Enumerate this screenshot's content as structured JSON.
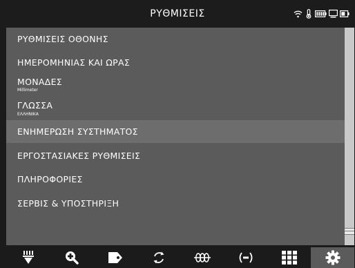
{
  "header": {
    "title": "ΡΥΘΜΙΣΕΙΣ"
  },
  "status_icons": [
    "wifi-icon",
    "temperature-icon",
    "battery-icon",
    "device-icon",
    "battery-level-icon"
  ],
  "menu": {
    "items": [
      {
        "label": "ΡΥΘΜΙΣΕΙΣ ΟΘΟΝΗΣ"
      },
      {
        "label": "ΗΜΕΡΟΜΗΝΙΑΣ ΚΑΙ ΩΡΑΣ"
      },
      {
        "label": "ΜΟΝΑΔΕΣ",
        "sub": "Millimeter"
      },
      {
        "label": "ΓΛΩΣΣΑ",
        "sub": "ΕΛΛΗΝΙΚΑ"
      },
      {
        "label": "ΕΝΗΜΕΡΩΣΗ ΣΥΣΤΗΜΑΤΟΣ",
        "highlighted": true
      },
      {
        "label": "ΕΡΓΟΣΤΑΣΙΑΚΕΣ ΡΥΘΜΙΣΕΙΣ"
      },
      {
        "label": "ΠΛΗΡΟΦΟΡΙΕΣ"
      },
      {
        "label": "ΣΕΡΒΙΣ & ΥΠΟΣΤΗΡΙΞΗ"
      }
    ]
  },
  "scrollbar": {
    "position": 0.95
  },
  "tabbar": {
    "tabs": [
      {
        "icon": "probe-icon"
      },
      {
        "icon": "zoom-in-icon"
      },
      {
        "icon": "tag-icon"
      },
      {
        "icon": "rotate-icon"
      },
      {
        "icon": "coil-icon"
      },
      {
        "icon": "signal-icon"
      },
      {
        "icon": "grid-icon"
      },
      {
        "icon": "gear-icon",
        "active": true
      }
    ]
  },
  "colors": {
    "background": "#1b1b1b",
    "menu_bg": "#5b5b5b",
    "highlight_bg": "#6d6d6d",
    "text": "#ffffff",
    "scroll_track": "#c9c9c9"
  }
}
